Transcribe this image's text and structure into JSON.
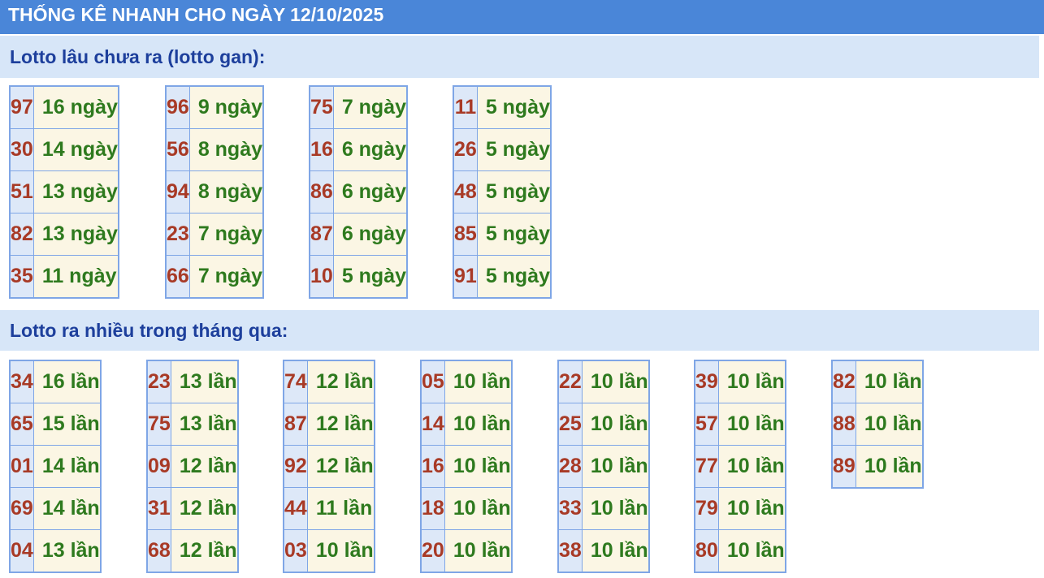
{
  "header": {
    "title": "THỐNG KÊ NHANH CHO NGÀY 12/10/2025"
  },
  "gan_section": {
    "title": "Lotto lâu chưa ra (lotto gan):",
    "tables": [
      {
        "rows": [
          {
            "num": "97",
            "val": "16 ngày"
          },
          {
            "num": "30",
            "val": "14 ngày"
          },
          {
            "num": "51",
            "val": "13 ngày"
          },
          {
            "num": "82",
            "val": "13 ngày"
          },
          {
            "num": "35",
            "val": "11 ngày"
          }
        ]
      },
      {
        "rows": [
          {
            "num": "96",
            "val": "9 ngày"
          },
          {
            "num": "56",
            "val": "8 ngày"
          },
          {
            "num": "94",
            "val": "8 ngày"
          },
          {
            "num": "23",
            "val": "7 ngày"
          },
          {
            "num": "66",
            "val": "7 ngày"
          }
        ]
      },
      {
        "rows": [
          {
            "num": "75",
            "val": "7 ngày"
          },
          {
            "num": "16",
            "val": "6 ngày"
          },
          {
            "num": "86",
            "val": "6 ngày"
          },
          {
            "num": "87",
            "val": "6 ngày"
          },
          {
            "num": "10",
            "val": "5 ngày"
          }
        ]
      },
      {
        "rows": [
          {
            "num": "11",
            "val": "5 ngày"
          },
          {
            "num": "26",
            "val": "5 ngày"
          },
          {
            "num": "48",
            "val": "5 ngày"
          },
          {
            "num": "85",
            "val": "5 ngày"
          },
          {
            "num": "91",
            "val": "5 ngày"
          }
        ]
      }
    ]
  },
  "freq_section": {
    "title": "Lotto ra nhiều trong tháng qua:",
    "tables": [
      {
        "rows": [
          {
            "num": "34",
            "val": "16 lần"
          },
          {
            "num": "65",
            "val": "15 lần"
          },
          {
            "num": "01",
            "val": "14 lần"
          },
          {
            "num": "69",
            "val": "14 lần"
          },
          {
            "num": "04",
            "val": "13 lần"
          }
        ]
      },
      {
        "rows": [
          {
            "num": "23",
            "val": "13 lần"
          },
          {
            "num": "75",
            "val": "13 lần"
          },
          {
            "num": "09",
            "val": "12 lần"
          },
          {
            "num": "31",
            "val": "12 lần"
          },
          {
            "num": "68",
            "val": "12 lần"
          }
        ]
      },
      {
        "rows": [
          {
            "num": "74",
            "val": "12 lần"
          },
          {
            "num": "87",
            "val": "12 lần"
          },
          {
            "num": "92",
            "val": "12 lần"
          },
          {
            "num": "44",
            "val": "11 lần"
          },
          {
            "num": "03",
            "val": "10 lần"
          }
        ]
      },
      {
        "rows": [
          {
            "num": "05",
            "val": "10 lần"
          },
          {
            "num": "14",
            "val": "10 lần"
          },
          {
            "num": "16",
            "val": "10 lần"
          },
          {
            "num": "18",
            "val": "10 lần"
          },
          {
            "num": "20",
            "val": "10 lần"
          }
        ]
      },
      {
        "rows": [
          {
            "num": "22",
            "val": "10 lần"
          },
          {
            "num": "25",
            "val": "10 lần"
          },
          {
            "num": "28",
            "val": "10 lần"
          },
          {
            "num": "33",
            "val": "10 lần"
          },
          {
            "num": "38",
            "val": "10 lần"
          }
        ]
      },
      {
        "rows": [
          {
            "num": "39",
            "val": "10 lần"
          },
          {
            "num": "57",
            "val": "10 lần"
          },
          {
            "num": "77",
            "val": "10 lần"
          },
          {
            "num": "79",
            "val": "10 lần"
          },
          {
            "num": "80",
            "val": "10 lần"
          }
        ]
      },
      {
        "rows": [
          {
            "num": "82",
            "val": "10 lần"
          },
          {
            "num": "88",
            "val": "10 lần"
          },
          {
            "num": "89",
            "val": "10 lần"
          }
        ]
      }
    ]
  },
  "colors": {
    "header_bg": "#4a86d8",
    "section_bg": "#d7e6f8",
    "section_text": "#1d3f9c",
    "number_text": "#a83a26",
    "value_text": "#2e7a1e",
    "number_cell_bg": "#dde8f8",
    "value_cell_bg": "#fbf6e4",
    "border": "#7fa6e6"
  }
}
